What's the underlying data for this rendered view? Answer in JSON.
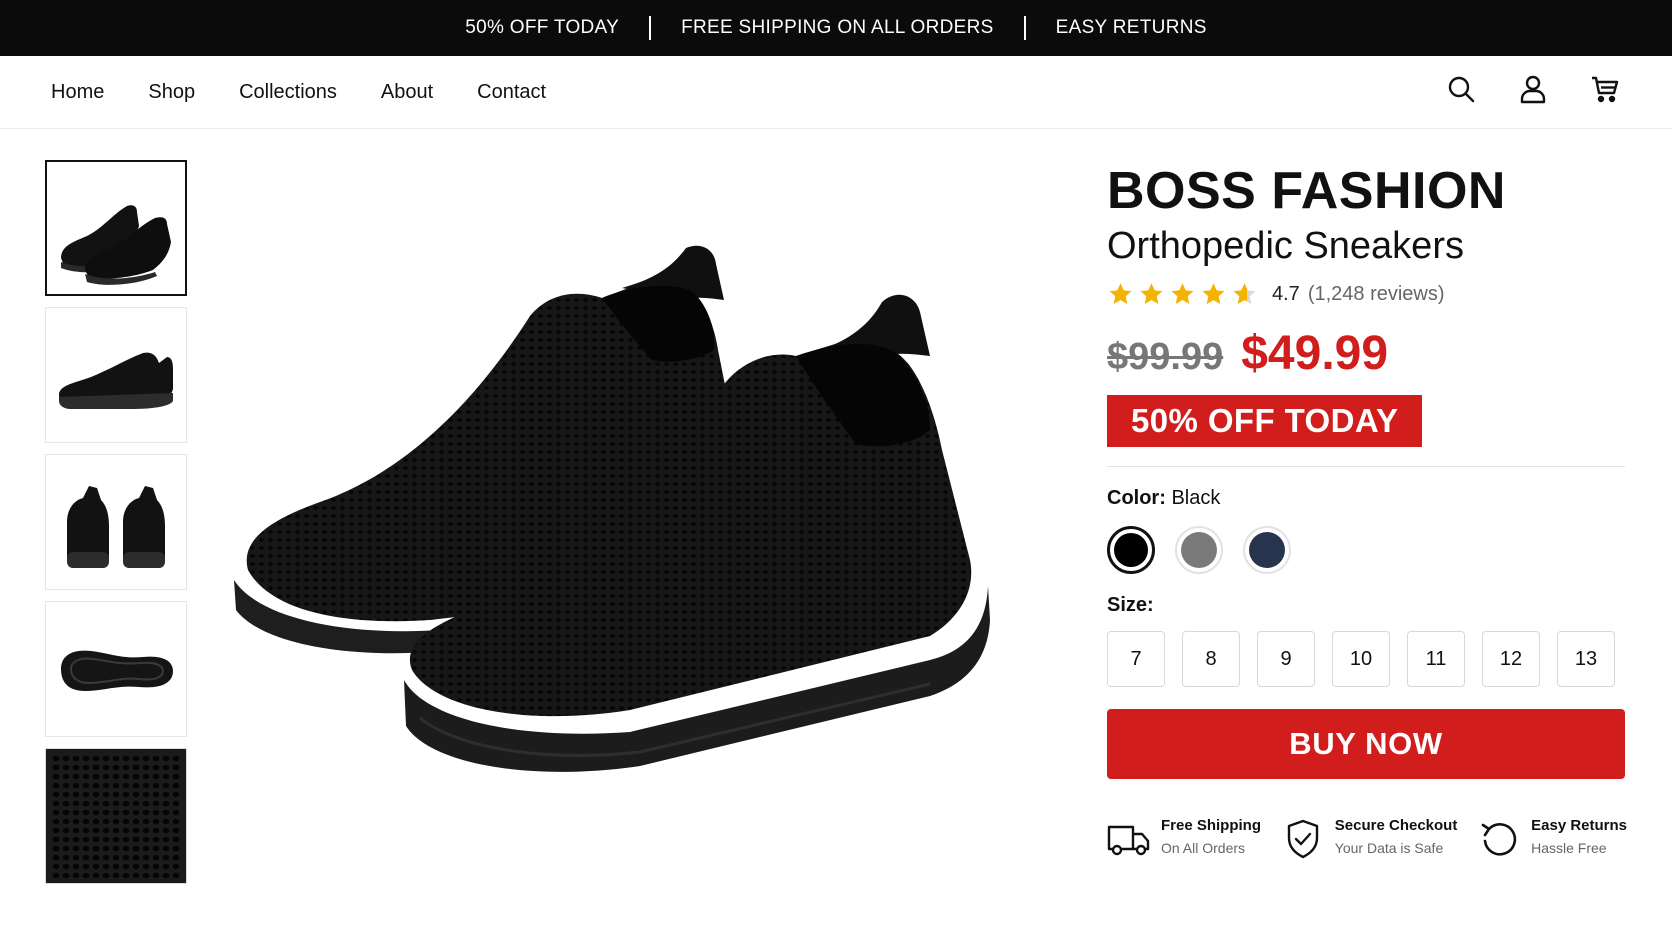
{
  "announcement": {
    "items": [
      "50% OFF TODAY",
      "FREE SHIPPING ON ALL ORDERS",
      "EASY RETURNS"
    ]
  },
  "nav": {
    "items": [
      "Home",
      "Shop",
      "Collections",
      "About",
      "Contact"
    ]
  },
  "header_icons": [
    "search-icon",
    "user-icon",
    "cart-icon"
  ],
  "gallery": {
    "thumbnails": [
      "pair-angle-view",
      "side-view",
      "back-view",
      "sole-view",
      "knit-detail"
    ],
    "selected_index": 0
  },
  "product": {
    "brand": "BOSS FASHION",
    "name": "Orthopedic Sneakers",
    "rating": 4.7,
    "rating_text": "4.7",
    "review_count_text": "(1,248 reviews)",
    "old_price": "$99.99",
    "price": "$49.99",
    "sale_badge": "50% OFF TODAY",
    "color_label": "Color:",
    "color_value": "Black",
    "colors": [
      {
        "name": "Black",
        "hex": "#000000",
        "selected": true
      },
      {
        "name": "Gray",
        "hex": "#7a7a7a",
        "selected": false
      },
      {
        "name": "Navy",
        "hex": "#27344d",
        "selected": false
      }
    ],
    "size_label": "Size:",
    "sizes": [
      "7",
      "8",
      "9",
      "10",
      "11",
      "12",
      "13"
    ],
    "buy_label": "BUY NOW"
  },
  "features": [
    {
      "icon": "truck-icon",
      "title": "Free Shipping",
      "subtitle": "On All Orders"
    },
    {
      "icon": "shield-check-icon",
      "title": "Secure Checkout",
      "subtitle": "Your Data is Safe"
    },
    {
      "icon": "return-icon",
      "title": "Easy Returns",
      "subtitle": "Hassle Free"
    }
  ],
  "colors": {
    "accent": "#d21d1d",
    "announcement_bg": "#0b0b0b",
    "star": "#f5b301"
  }
}
